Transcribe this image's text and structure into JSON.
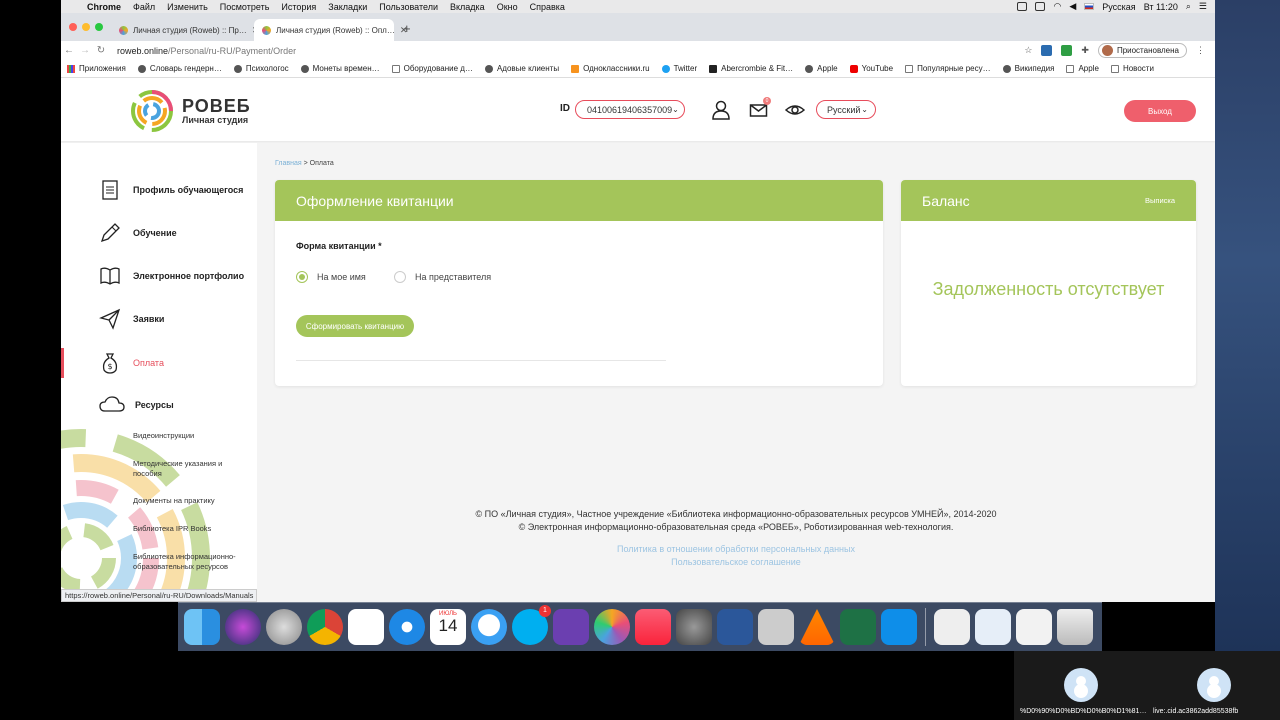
{
  "menubar": {
    "app": "Chrome",
    "items": [
      "Файл",
      "Изменить",
      "Посмотреть",
      "История",
      "Закладки",
      "Пользователи",
      "Вкладка",
      "Окно",
      "Справка"
    ],
    "keyboard": "Русская",
    "clock": "Вт 11:20"
  },
  "tabs": [
    {
      "title": "Личная студия (Roweb) :: Пр…"
    },
    {
      "title": "Личная студия (Roweb) :: Опл…"
    }
  ],
  "address": {
    "host": "roweb.online",
    "path": "/Personal/ru-RU/Payment/Order",
    "profile": "Приостановлена"
  },
  "bookmarks": [
    "Приложения",
    "Словарь гендерн…",
    "Психологос",
    "Монеты времен…",
    "Оборудование д…",
    "Адовые клиенты",
    "Одноклассники.ru",
    "Twitter",
    "Abercrombie & Fit…",
    "Apple",
    "YouTube",
    "Популярные ресу…",
    "Википедия",
    "Apple",
    "Новости"
  ],
  "header": {
    "brand_name": "РОВЕБ",
    "brand_sub": "Личная студия",
    "id_label": "ID",
    "id_value": "04100619406357009",
    "mail_badge": "0",
    "language": "Русский",
    "logout": "Выход"
  },
  "sidebar": {
    "items": [
      {
        "label": "Профиль обучающегося",
        "icon": "profile-icon"
      },
      {
        "label": "Обучение",
        "icon": "pencil-icon"
      },
      {
        "label": "Электронное портфолио",
        "icon": "book-icon"
      },
      {
        "label": "Заявки",
        "icon": "paper-plane-icon"
      },
      {
        "label": "Оплата",
        "icon": "money-bag-icon"
      },
      {
        "label": "Ресурсы",
        "icon": "cloud-icon"
      }
    ],
    "subitems": [
      "Видеоинструкции",
      "Методические указания и пособия",
      "Документы на практику",
      "Библиотека IPR Books",
      "Библиотека информационно-образовательных ресурсов"
    ]
  },
  "breadcrumb": {
    "home": "Главная",
    "sep": " > ",
    "current": "Оплата"
  },
  "receipt": {
    "title": "Оформление квитанции",
    "form_label": "Форма квитанции *",
    "options": [
      "На мое имя",
      "На представителя"
    ],
    "selected": 0,
    "submit": "Сформировать квитанцию"
  },
  "balance": {
    "title": "Баланс",
    "action": "Выписка",
    "status": "Задолженность отсутствует"
  },
  "footer": {
    "line1": "© ПО «Личная студия», Частное учреждение «Библиотека информационно-образовательных ресурсов УМНЕЙ», 2014-2020",
    "line2": "© Электронная информационно-образовательная среда «РОВЕБ», Роботизированная web-технология.",
    "link1": "Политика в отношении обработки персональных данных",
    "link2": "Пользовательское соглашение"
  },
  "status_url": "https://roweb.online/Personal/ru-RU/Downloads/Manuals",
  "dock": {
    "calendar_month": "ИЮЛЬ",
    "calendar_day": "14",
    "skype_badge": "1"
  },
  "participants": [
    "%D0%90%D0%BD%D0%B0%D1%81…",
    "live:.cid.ac3862add85538fb"
  ],
  "colors": {
    "accent_green": "#a4c55a",
    "accent_red": "#e64e5c"
  }
}
